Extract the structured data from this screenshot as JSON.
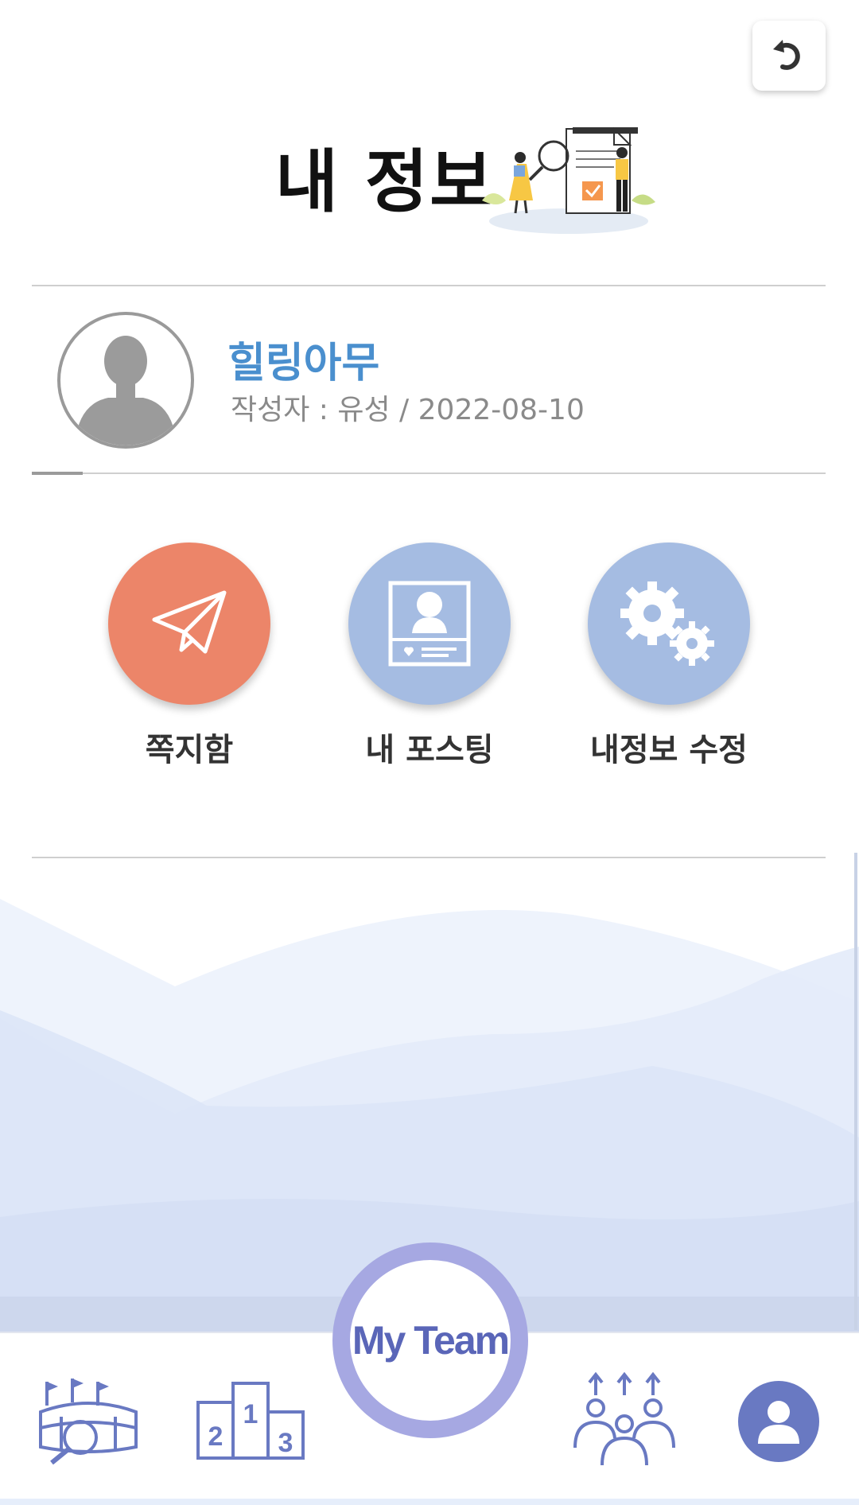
{
  "header": {
    "title": "내 정보",
    "back_icon": "undo-arrow-icon",
    "illustration": "document-search-illustration"
  },
  "profile": {
    "name": "힐링아무",
    "meta": "작성자 : 유성 / 2022-08-10",
    "avatar_icon": "person-silhouette-icon"
  },
  "actions": [
    {
      "label": "쪽지함",
      "icon": "paper-plane-icon",
      "color": "#ec8569"
    },
    {
      "label": "내 포스팅",
      "icon": "profile-card-icon",
      "color": "#a5bce2"
    },
    {
      "label": "내정보 수정",
      "icon": "gears-icon",
      "color": "#a5bce2"
    }
  ],
  "bottom_nav": {
    "center_label": "My Team",
    "items": [
      {
        "icon": "stadium-search-icon"
      },
      {
        "icon": "podium-ranking-icon"
      },
      {
        "icon": "people-group-icon"
      },
      {
        "icon": "user-profile-icon"
      }
    ]
  },
  "colors": {
    "accent_blue": "#4a8fce",
    "orange": "#ec8569",
    "light_blue": "#a5bce2",
    "nav_icon": "#6979c2",
    "ring": "#a6a8e2"
  }
}
